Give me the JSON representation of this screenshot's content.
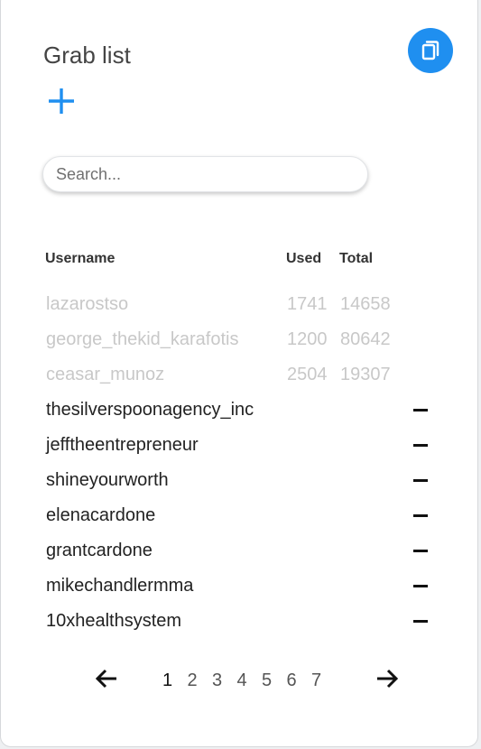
{
  "header": {
    "title": "Grab list"
  },
  "colors": {
    "accent": "#1f8ff0",
    "muted_text": "#c8c8c8",
    "text": "#222222"
  },
  "icons": {
    "copy": "copy-icon",
    "add": "plus-icon",
    "remove": "minus-icon",
    "prev": "arrow-left-icon",
    "next": "arrow-right-icon"
  },
  "search": {
    "placeholder": "Search...",
    "value": ""
  },
  "table": {
    "headers": {
      "username": "Username",
      "used": "Used",
      "total": "Total"
    },
    "rows": [
      {
        "username": "lazarostso",
        "used": "1741",
        "total": "14658",
        "done": true
      },
      {
        "username": "george_thekid_karafotis",
        "used": "1200",
        "total": "80642",
        "done": true
      },
      {
        "username": "ceasar_munoz",
        "used": "2504",
        "total": "19307",
        "done": true
      },
      {
        "username": "thesilverspoonagency_inc",
        "used": "",
        "total": "",
        "done": false
      },
      {
        "username": "jefftheentrepreneur",
        "used": "",
        "total": "",
        "done": false
      },
      {
        "username": "shineyourworth",
        "used": "",
        "total": "",
        "done": false
      },
      {
        "username": "elenacardone",
        "used": "",
        "total": "",
        "done": false
      },
      {
        "username": "grantcardone",
        "used": "",
        "total": "",
        "done": false
      },
      {
        "username": "mikechandlermma",
        "used": "",
        "total": "",
        "done": false
      },
      {
        "username": "10xhealthsystem",
        "used": "",
        "total": "",
        "done": false
      }
    ]
  },
  "pagination": {
    "pages": [
      "1",
      "2",
      "3",
      "4",
      "5",
      "6",
      "7"
    ],
    "current": "1"
  }
}
